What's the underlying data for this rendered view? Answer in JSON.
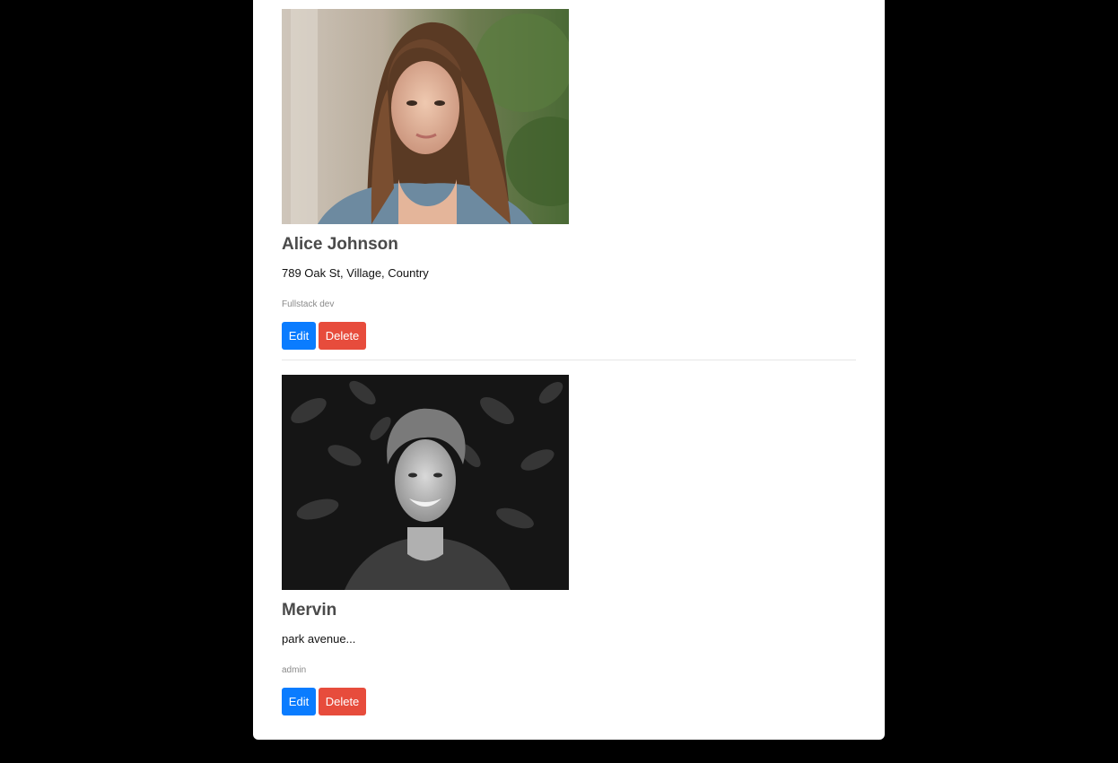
{
  "users": [
    {
      "name": "Alice Johnson",
      "address": "789 Oak St, Village, Country",
      "role": "Fullstack dev",
      "edit_label": "Edit",
      "delete_label": "Delete"
    },
    {
      "name": "Mervin",
      "address": "park avenue...",
      "role": "admin",
      "edit_label": "Edit",
      "delete_label": "Delete"
    }
  ],
  "colors": {
    "edit_button": "#0a7cff",
    "delete_button": "#e74c3c",
    "page_background": "#000000",
    "card_background": "#ffffff"
  }
}
